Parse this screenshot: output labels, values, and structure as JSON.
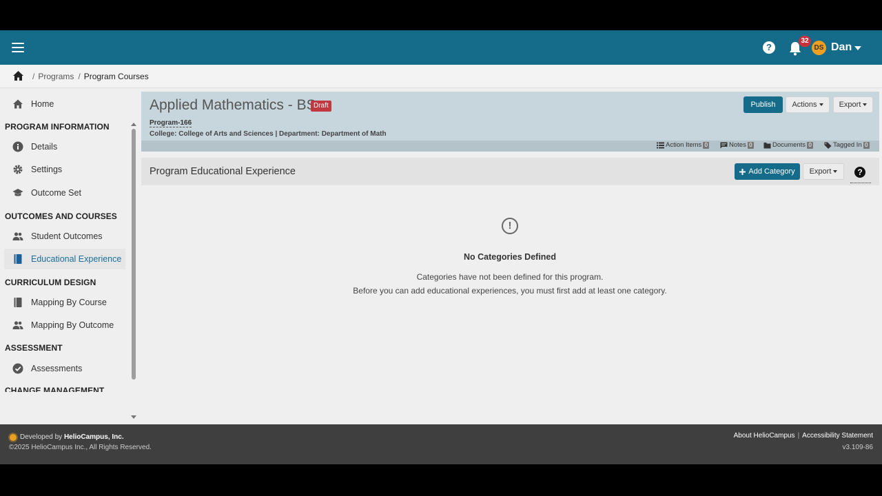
{
  "topbar": {
    "notification_count": "32",
    "avatar_initials": "DS",
    "user_name": "Dan"
  },
  "breadcrumb": {
    "items": [
      "Programs",
      "Program Courses"
    ]
  },
  "sidebar": {
    "home": "Home",
    "sections": {
      "program_information": "PROGRAM INFORMATION",
      "outcomes_and_courses": "OUTCOMES AND COURSES",
      "curriculum_design": "CURRICULUM DESIGN",
      "assessment": "ASSESSMENT",
      "change_management": "CHANGE MANAGEMENT"
    },
    "items": {
      "details": "Details",
      "settings": "Settings",
      "outcome_set": "Outcome Set",
      "student_outcomes": "Student Outcomes",
      "educational_experience": "Educational Experience",
      "mapping_by_course": "Mapping By Course",
      "mapping_by_outcome": "Mapping By Outcome",
      "assessments": "Assessments"
    }
  },
  "program": {
    "title": "Applied Mathematics - BS",
    "status_badge": "Draft",
    "program_id": "Program-166",
    "meta": "College: College of Arts and Sciences | Department: Department of Math",
    "publish_label": "Publish",
    "actions_label": "Actions",
    "export_label": "Export",
    "action_items_label": "Action Items",
    "action_items_count": "0",
    "notes_label": "Notes",
    "notes_count": "0",
    "documents_label": "Documents",
    "documents_count": "0",
    "tagged_in_label": "Tagged In",
    "tagged_in_count": "0"
  },
  "section": {
    "title": "Program Educational Experience",
    "add_category_label": "Add Category",
    "export_label": "Export"
  },
  "empty_state": {
    "title": "No Categories Defined",
    "line1": "Categories have not been defined for this program.",
    "line2": "Before you can add educational experiences, you must first add at least one category."
  },
  "footer": {
    "developed_by_prefix": "Developed by",
    "developed_by_company": "HelioCampus, Inc.",
    "copyright": "©2025 HelioCampus Inc., All Rights Reserved.",
    "about_link": "About HelioCampus",
    "accessibility_link": "Accessibility Statement",
    "version": "v3.109-86"
  },
  "colors": {
    "brand": "#156b8a",
    "draft": "#c13841",
    "header_card": "#c7d6dc"
  }
}
